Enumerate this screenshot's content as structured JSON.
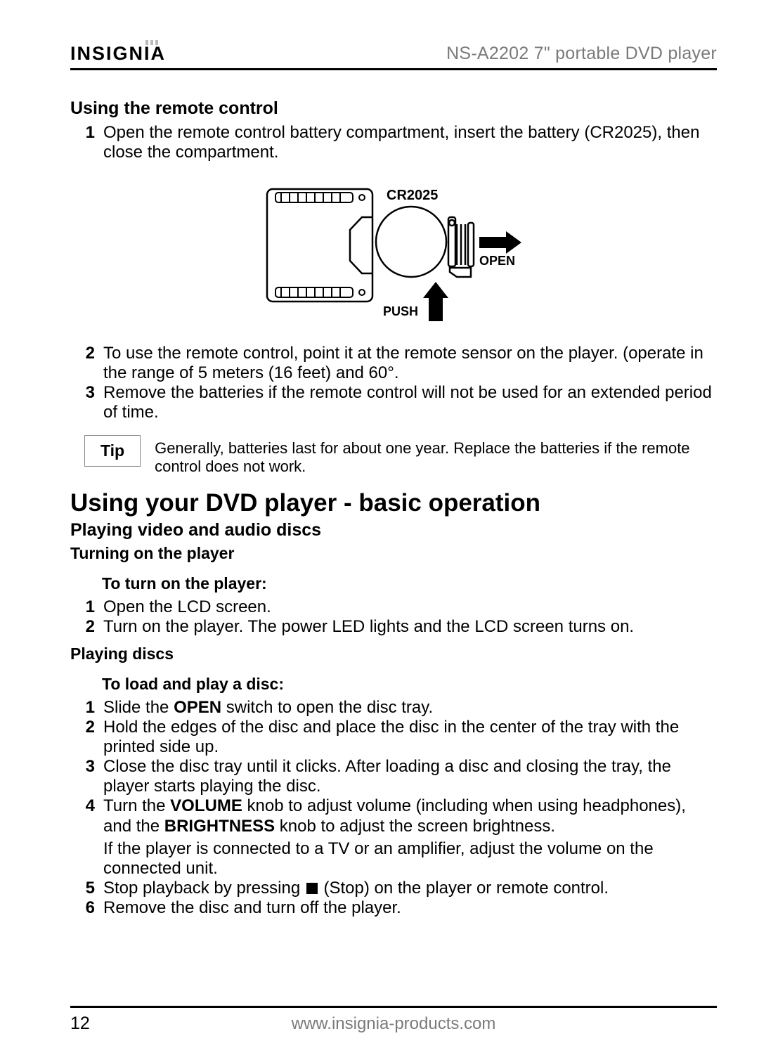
{
  "header": {
    "brand": "INSIGNIA",
    "product": "NS-A2202 7\" portable DVD player"
  },
  "section1": {
    "title": "Using the remote control",
    "steps": [
      "Open the remote control battery compartment, insert the battery (CR2025), then close the compartment.",
      "To use the remote control, point it at the remote sensor on the player. (operate in the range of 5 meters (16 feet) and 60°.",
      "Remove the batteries if the remote control will not be used for an extended period of time."
    ]
  },
  "diagram": {
    "battery_label": "CR2025",
    "open_label": "OPEN",
    "push_label": "PUSH"
  },
  "tip": {
    "label": "Tip",
    "text": "Generally, batteries last for about one year. Replace the batteries if the remote control does not work."
  },
  "section2": {
    "title": "Using your DVD player - basic operation",
    "sub1": "Playing video and audio discs",
    "sub1a": "Turning on the player",
    "sub1a_intro": "To turn on the player:",
    "sub1a_steps": [
      "Open the LCD screen.",
      "Turn on the player. The power LED lights and the LCD screen turns on."
    ],
    "sub1b": "Playing discs",
    "sub1b_intro": "To load and play a disc:",
    "sub1b_steps": {
      "s1_pre": "Slide the ",
      "s1_bold": "OPEN",
      "s1_post": " switch to open the disc tray.",
      "s2": "Hold the edges of the disc and place the disc in the center of the tray with the printed side up.",
      "s3": "Close the disc tray until it clicks. After loading a disc and closing the tray, the player starts playing the disc.",
      "s4_pre": "Turn the ",
      "s4_b1": "VOLUME",
      "s4_mid": " knob to adjust volume (including when using headphones), and the ",
      "s4_b2": "BRIGHTNESS",
      "s4_post": " knob to adjust the screen brightness.",
      "s4_note": "If the player is connected to a TV or an amplifier, adjust the volume on the connected unit.",
      "s5_pre": "Stop playback by pressing ",
      "s5_post": " (Stop) on the player or remote control.",
      "s6": "Remove the disc and turn off the player."
    }
  },
  "footer": {
    "page": "12",
    "url": "www.insignia-products.com"
  },
  "nums": {
    "n1": "1",
    "n2": "2",
    "n3": "3",
    "n4": "4",
    "n5": "5",
    "n6": "6"
  }
}
